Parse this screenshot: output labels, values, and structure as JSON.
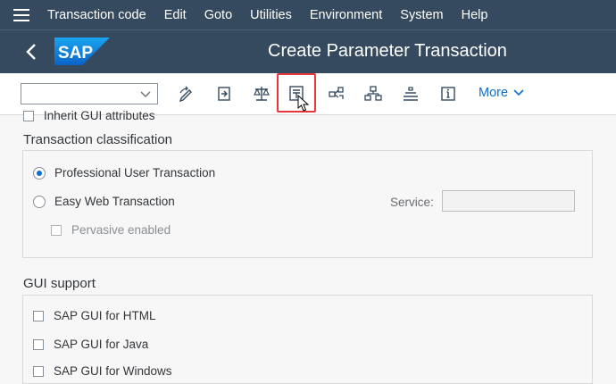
{
  "menu": {
    "items": [
      {
        "label": "Transaction code"
      },
      {
        "label": "Edit"
      },
      {
        "label": "Goto"
      },
      {
        "label": "Utilities"
      },
      {
        "label": "Environment"
      },
      {
        "label": "System"
      },
      {
        "label": "Help"
      }
    ]
  },
  "header": {
    "logo_text": "SAP",
    "title": "Create Parameter Transaction"
  },
  "toolbar": {
    "command_field_value": "",
    "more_label": "More",
    "buttons": [
      {
        "icon": "display-change-icon"
      },
      {
        "icon": "export-icon"
      },
      {
        "icon": "balance-scale-icon"
      },
      {
        "icon": "table-filter-icon",
        "highlighted": true
      },
      {
        "icon": "navigate-objects-icon"
      },
      {
        "icon": "hierarchy-icon"
      },
      {
        "icon": "stacked-layers-icon"
      },
      {
        "icon": "info-icon"
      }
    ]
  },
  "content": {
    "partial_checkbox_label": "Inherit GUI attributes",
    "transaction_classification": {
      "title": "Transaction classification",
      "professional_label": "Professional User Transaction",
      "professional_selected": true,
      "easy_web_label": "Easy Web Transaction",
      "easy_web_selected": false,
      "service_label": "Service:",
      "service_value": "",
      "pervasive_label": "Pervasive enabled"
    },
    "gui_support": {
      "title": "GUI support",
      "options": [
        {
          "label": "SAP GUI for HTML"
        },
        {
          "label": "SAP GUI for Java"
        },
        {
          "label": "SAP GUI for Windows"
        }
      ]
    }
  },
  "colors": {
    "shell": "#354a5f",
    "accent": "#0a6ed1",
    "highlight": "#e8363c"
  }
}
